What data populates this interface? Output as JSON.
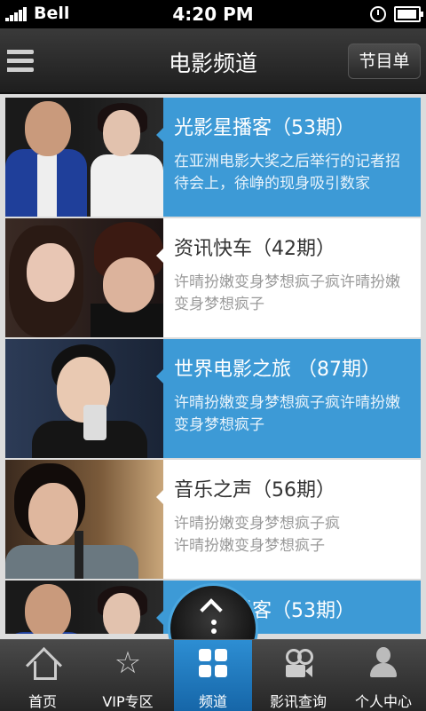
{
  "status_bar": {
    "carrier": "Bell",
    "time": "4:20 PM"
  },
  "header": {
    "title": "电影频道",
    "schedule_button": "节目单"
  },
  "items": [
    {
      "title": "光影星播客（53期）",
      "desc": "在亚洲电影大奖之后举行的记者招待会上，徐峥的现身吸引数家",
      "active": true
    },
    {
      "title": "资讯快车（42期）",
      "desc": "许晴扮嫩变身梦想疯子疯许晴扮嫩变身梦想疯子",
      "active": false
    },
    {
      "title": "世界电影之旅 （87期）",
      "desc": "许晴扮嫩变身梦想疯子疯许晴扮嫩变身梦想疯子",
      "active": true
    },
    {
      "title": "音乐之声（56期）",
      "desc": "许晴扮嫩变身梦想疯子疯\n许晴扮嫩变身梦想疯子",
      "active": false
    },
    {
      "title": "光影星播客（53期）",
      "desc": "",
      "active": true
    }
  ],
  "tabs": [
    {
      "label": "首页",
      "icon": "home-icon"
    },
    {
      "label": "VIP专区",
      "icon": "star-icon"
    },
    {
      "label": "频道",
      "icon": "grid-icon",
      "active": true
    },
    {
      "label": "影讯查询",
      "icon": "camera-icon"
    },
    {
      "label": "个人中心",
      "icon": "user-icon"
    }
  ],
  "colors": {
    "accent": "#3d9ad6",
    "tab_active": "#1f7bc0"
  }
}
